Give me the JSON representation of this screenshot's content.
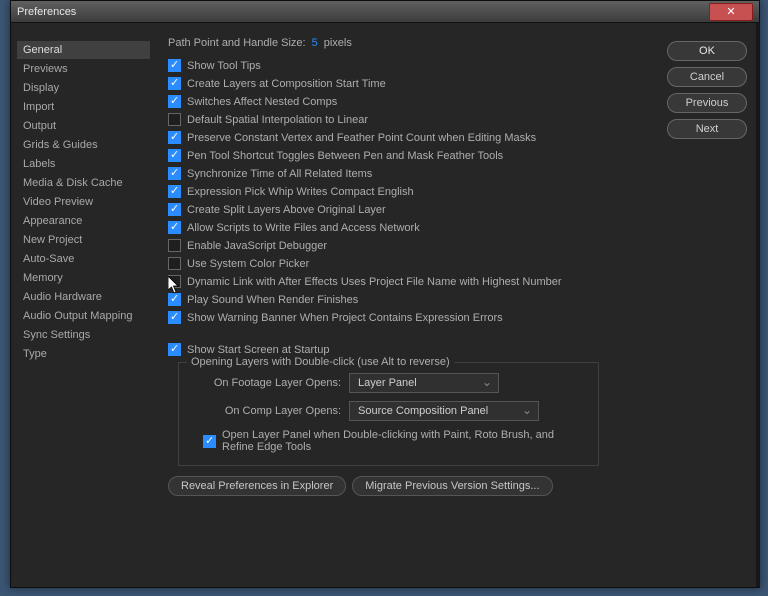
{
  "title": "Preferences",
  "buttons": {
    "ok": "OK",
    "cancel": "Cancel",
    "previous": "Previous",
    "next": "Next"
  },
  "sidebar": {
    "items": [
      "General",
      "Previews",
      "Display",
      "Import",
      "Output",
      "Grids & Guides",
      "Labels",
      "Media & Disk Cache",
      "Video Preview",
      "Appearance",
      "New Project",
      "Auto-Save",
      "Memory",
      "Audio Hardware",
      "Audio Output Mapping",
      "Sync Settings",
      "Type"
    ],
    "selected": 0
  },
  "path": {
    "label": "Path Point and Handle Size:",
    "value": "5",
    "unit": "pixels"
  },
  "checks": [
    {
      "on": true,
      "label": "Show Tool Tips"
    },
    {
      "on": true,
      "label": "Create Layers at Composition Start Time"
    },
    {
      "on": true,
      "label": "Switches Affect Nested Comps"
    },
    {
      "on": false,
      "label": "Default Spatial Interpolation to Linear"
    },
    {
      "on": true,
      "label": "Preserve Constant Vertex and Feather Point Count when Editing Masks"
    },
    {
      "on": true,
      "label": "Pen Tool Shortcut Toggles Between Pen and Mask Feather Tools"
    },
    {
      "on": true,
      "label": "Synchronize Time of All Related Items"
    },
    {
      "on": true,
      "label": "Expression Pick Whip Writes Compact English"
    },
    {
      "on": true,
      "label": "Create Split Layers Above Original Layer"
    },
    {
      "on": true,
      "label": "Allow Scripts to Write Files and Access Network"
    },
    {
      "on": false,
      "label": "Enable JavaScript Debugger"
    },
    {
      "on": false,
      "label": "Use System Color Picker"
    },
    {
      "on": false,
      "label": "Dynamic Link with After Effects Uses Project File Name with Highest Number"
    },
    {
      "on": true,
      "label": "Play Sound When Render Finishes"
    },
    {
      "on": true,
      "label": "Show Warning Banner When Project Contains Expression Errors"
    }
  ],
  "startup": {
    "on": true,
    "label": "Show Start Screen at Startup"
  },
  "doubleclick": {
    "legend": "Opening Layers with Double-click (use Alt to reverse)",
    "footage_label": "On Footage Layer Opens:",
    "footage_value": "Layer Panel",
    "comp_label": "On Comp Layer Opens:",
    "comp_value": "Source Composition Panel",
    "open_panel": {
      "on": true,
      "label": "Open Layer Panel when Double-clicking with Paint, Roto Brush, and Refine Edge Tools"
    }
  },
  "bottom": {
    "reveal": "Reveal Preferences in Explorer",
    "migrate": "Migrate Previous Version Settings..."
  }
}
